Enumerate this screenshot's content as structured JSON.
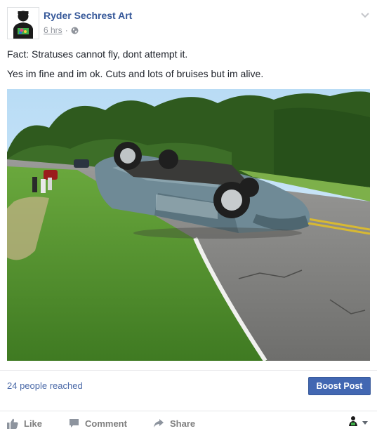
{
  "post": {
    "page_name": "Ryder Sechrest Art",
    "time": "6 hrs",
    "separator": "·",
    "lines": [
      "Fact: Stratuses cannot fly, dont attempt it.",
      "Yes im fine and im ok. Cuts and lots of bruises but im alive."
    ]
  },
  "insights": {
    "reach": "24 people reached",
    "boost_label": "Boost Post"
  },
  "actions": {
    "like": "Like",
    "comment": "Comment",
    "share": "Share"
  },
  "icons": {
    "audience": "globe-icon",
    "menu": "chevron-down-icon",
    "like": "thumbs-up-icon",
    "comment": "comment-icon",
    "share": "share-arrow-icon",
    "reactor": "avatar-icon"
  },
  "colors": {
    "link": "#365899",
    "button": "#4267b2",
    "muted": "#90949c"
  }
}
